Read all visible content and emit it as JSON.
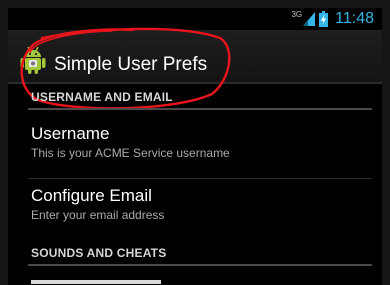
{
  "status_bar": {
    "network_type": "3G",
    "time": "11:48",
    "accent_color": "#33b5e5"
  },
  "action_bar": {
    "title": "Simple User Prefs",
    "icon": "android-robot-icon"
  },
  "annotation": {
    "color": "#e8141c",
    "shape": "hand-drawn-circle"
  },
  "preferences": {
    "categories": [
      {
        "header": "USERNAME AND EMAIL",
        "items": [
          {
            "title": "Username",
            "summary": "This is your ACME Service username"
          },
          {
            "title": "Configure Email",
            "summary": "Enter your email address"
          }
        ]
      },
      {
        "header": "SOUNDS AND CHEATS",
        "items": []
      }
    ]
  }
}
